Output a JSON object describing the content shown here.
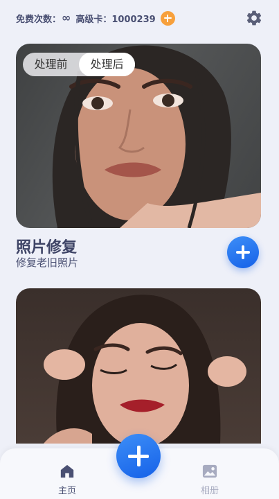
{
  "header": {
    "free_label": "免费次数：",
    "free_value": "∞",
    "card_label": "高级卡：1000239",
    "icons": {
      "add": "plus-circle-icon",
      "settings": "gear-icon"
    },
    "accent": "#f7a03c"
  },
  "feature": {
    "toggle": {
      "before": "处理前",
      "after": "处理后",
      "selected": "处理后"
    },
    "title": "照片修复",
    "subtitle": "修复老旧照片"
  },
  "bottom_nav": {
    "items": [
      {
        "label": "主页",
        "icon": "home-icon",
        "active": true
      },
      {
        "label": "相册",
        "icon": "image-icon",
        "active": false
      }
    ],
    "primary_color": "#1f6ef0"
  }
}
